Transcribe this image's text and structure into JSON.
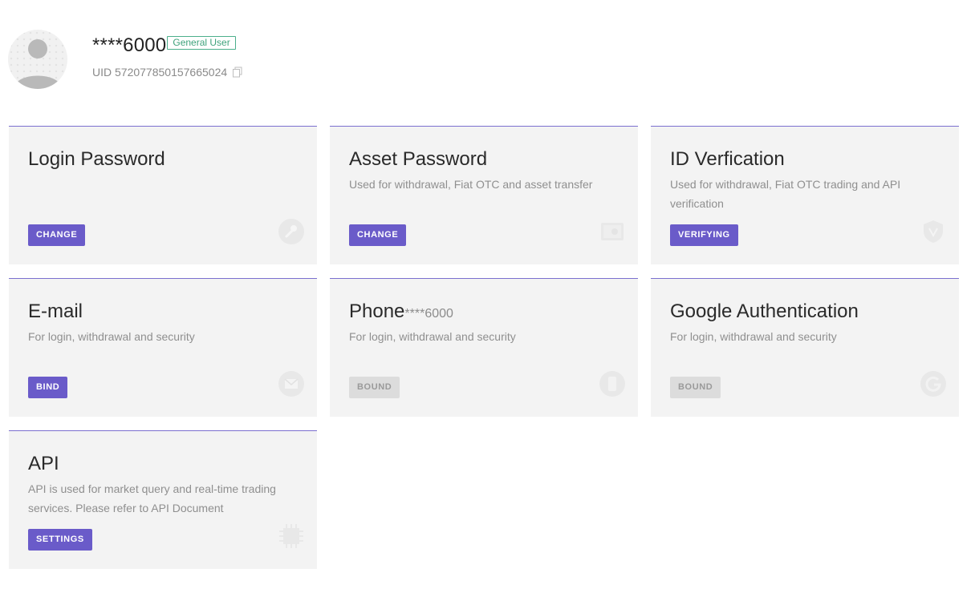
{
  "profile": {
    "username": "****6000",
    "badge": "General User",
    "uid": "UID 572077850157665024"
  },
  "cards": [
    {
      "title": "Login Password",
      "title_suffix": "",
      "description": "",
      "button": "CHANGE",
      "button_state": "active",
      "icon": "wrench-icon"
    },
    {
      "title": "Asset Password",
      "title_suffix": "",
      "description": "Used for withdrawal, Fiat OTC and asset transfer",
      "button": "CHANGE",
      "button_state": "active",
      "icon": "safe-icon"
    },
    {
      "title": "ID Verfication",
      "title_suffix": "",
      "description": "Used for withdrawal, Fiat OTC trading and API verification",
      "button": "VERIFYING",
      "button_state": "active",
      "icon": "shield-icon"
    },
    {
      "title": "E-mail",
      "title_suffix": "",
      "description": "For login, withdrawal and security",
      "button": "BIND",
      "button_state": "active",
      "icon": "mail-icon"
    },
    {
      "title": "Phone",
      "title_suffix": "****6000",
      "description": "For login, withdrawal and security",
      "button": "BOUND",
      "button_state": "disabled",
      "icon": "phone-icon"
    },
    {
      "title": "Google Authentication",
      "title_suffix": "",
      "description": "For login, withdrawal and security",
      "button": "BOUND",
      "button_state": "disabled",
      "icon": "google-icon"
    },
    {
      "title": "API",
      "title_suffix": "",
      "description": "API is used for market query and real-time trading services. Please refer to API Document",
      "button": "SETTINGS",
      "button_state": "active",
      "icon": "chip-icon"
    }
  ],
  "colors": {
    "accent": "#6a5bc9",
    "card_border": "#7b6fcf",
    "card_bg": "#f3f3f3",
    "badge": "#3fa27c",
    "disabled_button": "#dcdcdc"
  }
}
